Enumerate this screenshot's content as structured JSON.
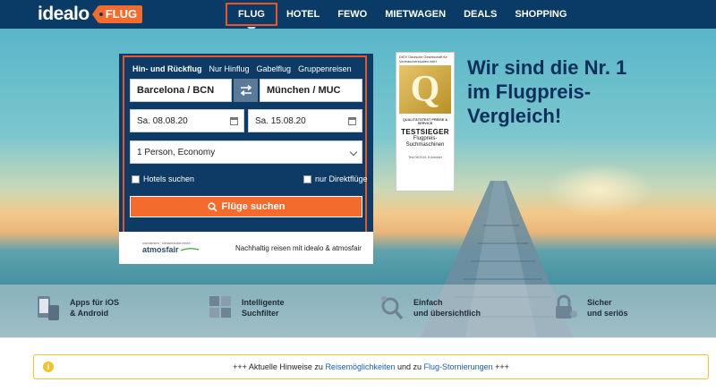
{
  "header": {
    "logo_text": "idealo",
    "logo_tag": "FLUG",
    "nav": [
      "FLUG",
      "HOTEL",
      "FEWO",
      "MIETWAGEN",
      "DEALS",
      "SHOPPING"
    ]
  },
  "search": {
    "tabs": [
      "Hin- und Rückflug",
      "Nur Hinflug",
      "Gabelflug",
      "Gruppenreisen"
    ],
    "from": "Barcelona / BCN",
    "to": "München / MUC",
    "date_out": "Sa. 08.08.20",
    "date_back": "Sa. 15.08.20",
    "passengers": "1 Person, Economy",
    "hotels_label": "Hotels suchen",
    "direct_label": "nur Direktflüge",
    "submit_label": "Flüge suchen"
  },
  "atmosfair": {
    "logo_small": "nachdenken · klimabewusst reisen",
    "logo_big": "atmosfair",
    "text": "Nachhaltig reisen mit idealo & atmosfair"
  },
  "badge": {
    "top": "DtGV Deutsche Gesellschaft für Verbraucherstudien mbH",
    "seal": "Q",
    "line1": "QUALITÄTSTEST PREISE & SERVICE",
    "title": "TESTSIEGER",
    "sub1": "Flugpreis-",
    "sub2": "Suchmaschinen",
    "foot": "Test 05/2019, 8 Anbieter"
  },
  "headline": {
    "line1": "Wir sind die Nr. 1",
    "line2": "im Flugpreis-",
    "line3": "Vergleich!"
  },
  "features": [
    {
      "line1": "Apps für iOS",
      "line2": "& Android",
      "icon": "phone-icon"
    },
    {
      "line1": "Intelligente",
      "line2": "Suchfilter",
      "icon": "puzzle-icon"
    },
    {
      "line1": "Einfach",
      "line2": "und übersichtlich",
      "icon": "magnifier-icon"
    },
    {
      "line1": "Sicher",
      "line2": "und seriös",
      "icon": "lock-icon"
    }
  ],
  "notice": {
    "prefix": "+++ Aktuelle Hinweise zu ",
    "link1": "Reisemöglichkeiten",
    "middle": " und zu ",
    "link2": "Flug-Stornierungen",
    "suffix": " +++"
  },
  "colors": {
    "header_bg": "#0a3a66",
    "accent": "#f46b2e",
    "panel_bg": "#0d3b66",
    "headline": "#0b2f5a"
  }
}
